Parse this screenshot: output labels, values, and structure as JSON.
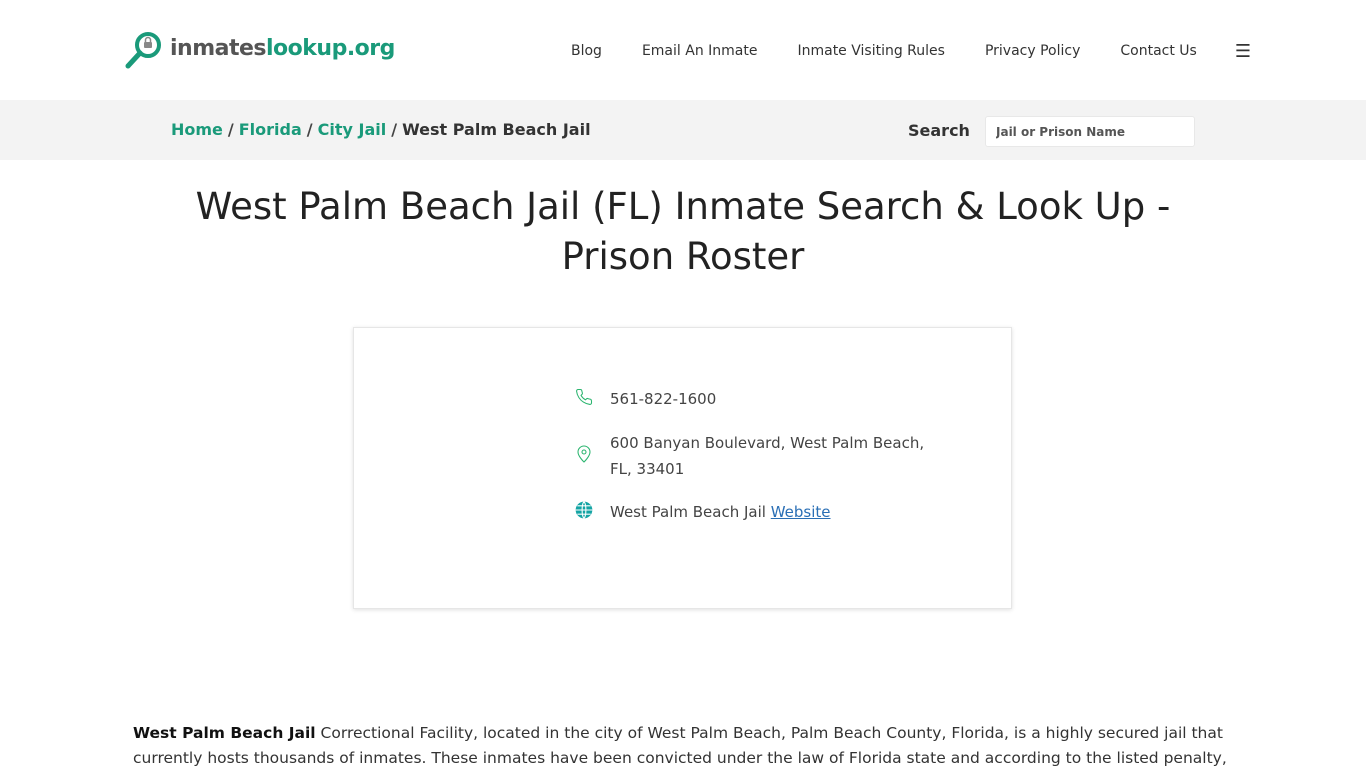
{
  "header": {
    "logo": {
      "part1": "inmates",
      "part2": "lookup.org"
    },
    "nav": [
      "Blog",
      "Email An Inmate",
      "Inmate Visiting Rules",
      "Privacy Policy",
      "Contact Us"
    ],
    "menu_icon": "hamburger-icon"
  },
  "breadcrumb": {
    "items": [
      "Home",
      "Florida",
      "City Jail"
    ],
    "current": "West Palm Beach Jail",
    "separator": "/"
  },
  "search": {
    "label": "Search",
    "placeholder": "Jail or Prison Name"
  },
  "page": {
    "title": "West Palm Beach Jail (FL) Inmate Search & Look Up - Prison Roster"
  },
  "contact": {
    "phone": "561-822-1600",
    "address": "600 Banyan Boulevard, West Palm Beach, FL, 33401",
    "website_prefix": "West Palm Beach Jail",
    "website_link": "Website",
    "icons": [
      "phone-icon",
      "map-pin-icon",
      "globe-icon"
    ]
  },
  "body": {
    "lead": "West Palm Beach Jail",
    "text": " Correctional Facility, located in the city of West Palm Beach, Palm Beach County, Florida, is a highly secured jail that currently hosts thousands of inmates. These inmates have been convicted under the law of Florida state and according to the listed penalty,"
  },
  "colors": {
    "brand_green": "#1a9a7a",
    "link_blue": "#2a6fb5",
    "bar_bg": "#f3f3f3"
  }
}
